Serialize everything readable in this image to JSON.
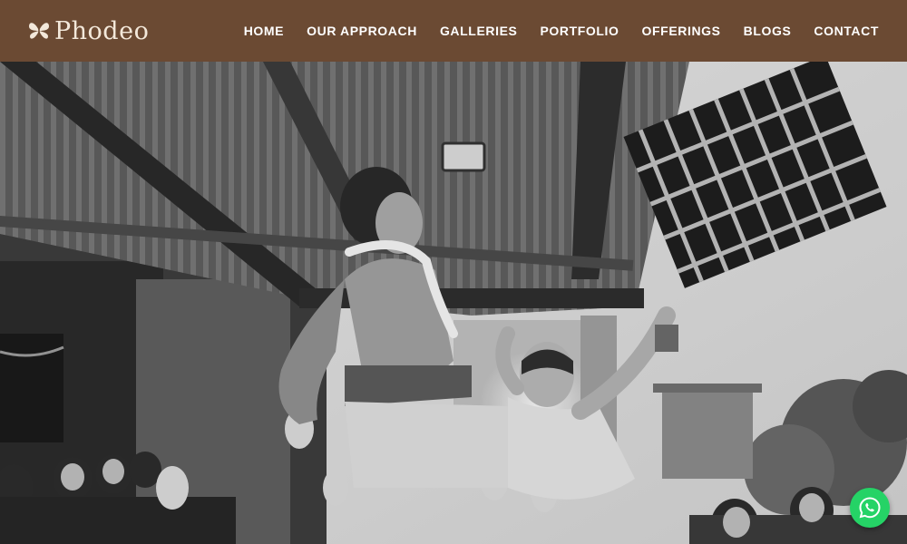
{
  "brand": {
    "name": "Phodeo",
    "logo_icon": "butterfly-icon",
    "color": "#6b4a33"
  },
  "nav": {
    "items": [
      {
        "label": "HOME"
      },
      {
        "label": "OUR APPROACH"
      },
      {
        "label": "GALLERIES"
      },
      {
        "label": "PORTFOLIO"
      },
      {
        "label": "OFFERINGS"
      },
      {
        "label": "BLOGS"
      },
      {
        "label": "CONTACT"
      }
    ]
  },
  "hero": {
    "style": "black-and-white wedding photograph"
  },
  "floating": {
    "icon": "whatsapp-icon",
    "color": "#25d366"
  }
}
